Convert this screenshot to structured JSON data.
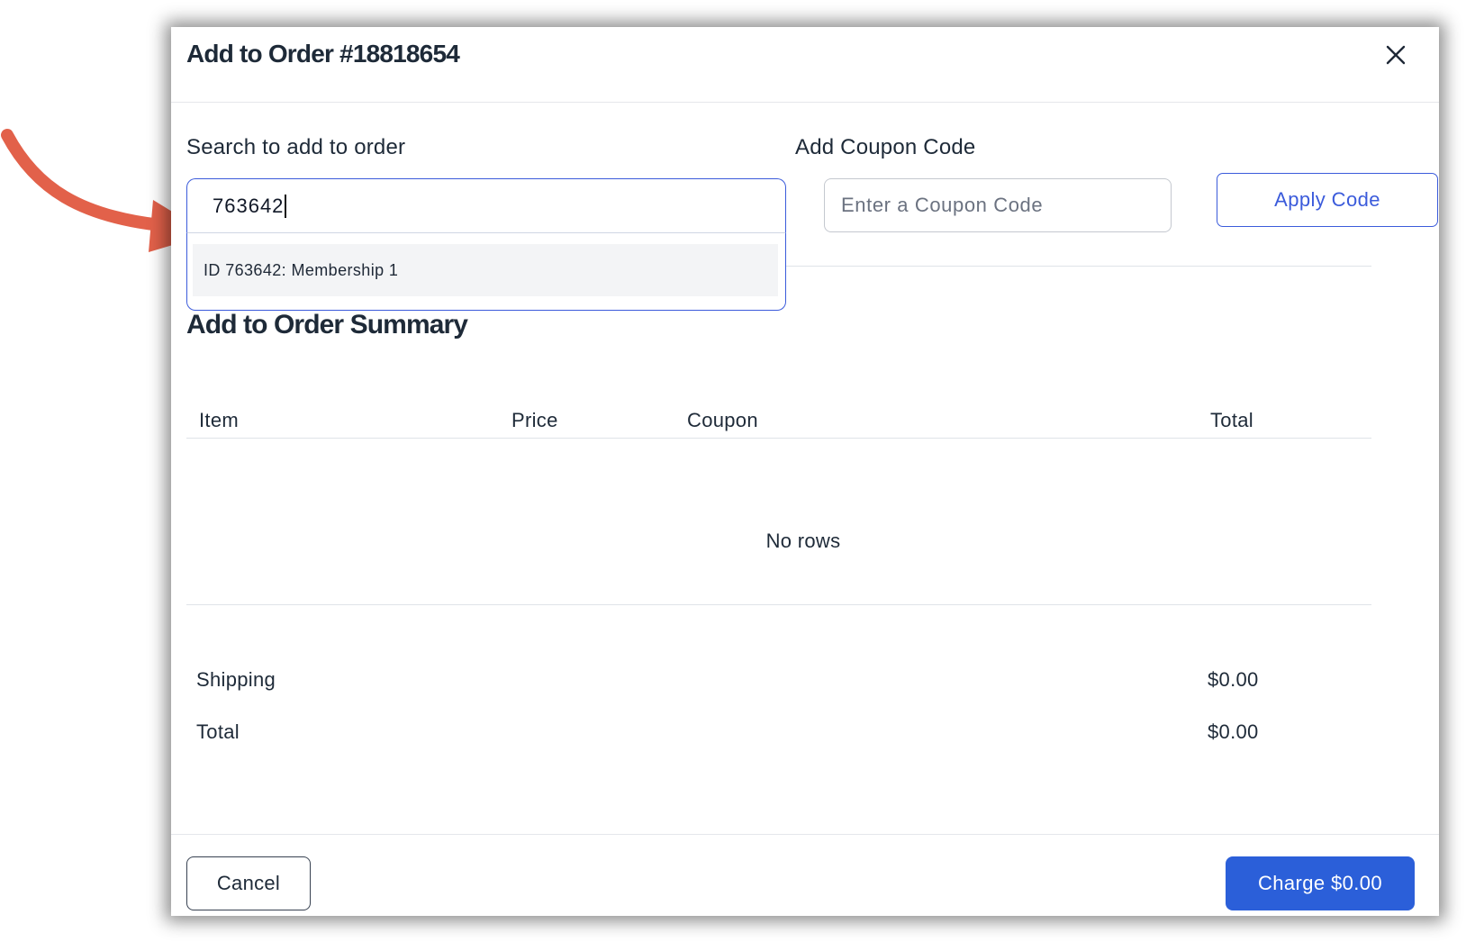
{
  "modal": {
    "title": "Add to Order #18818654",
    "close_icon": "close-icon"
  },
  "search": {
    "label": "Search to add to order",
    "value": "763642",
    "results": [
      {
        "label": "ID 763642: Membership 1"
      }
    ]
  },
  "coupon": {
    "label": "Add Coupon Code",
    "placeholder": "Enter a Coupon Code",
    "value": "",
    "apply_label": "Apply Code"
  },
  "summary": {
    "title": "Add to Order Summary",
    "columns": [
      "Item",
      "Price",
      "Coupon",
      "Total"
    ],
    "empty_text": "No rows",
    "shipping_label": "Shipping",
    "shipping_value": "$0.00",
    "total_label": "Total",
    "total_value": "$0.00"
  },
  "footer": {
    "cancel_label": "Cancel",
    "charge_label": "Charge $0.00"
  },
  "annotation": {
    "arrow_icon": "curved-arrow-icon"
  },
  "colors": {
    "primary": "#2b5fd9",
    "focus_border": "#3b5bdb",
    "arrow": "#e2614a",
    "text": "#1e2a38"
  }
}
